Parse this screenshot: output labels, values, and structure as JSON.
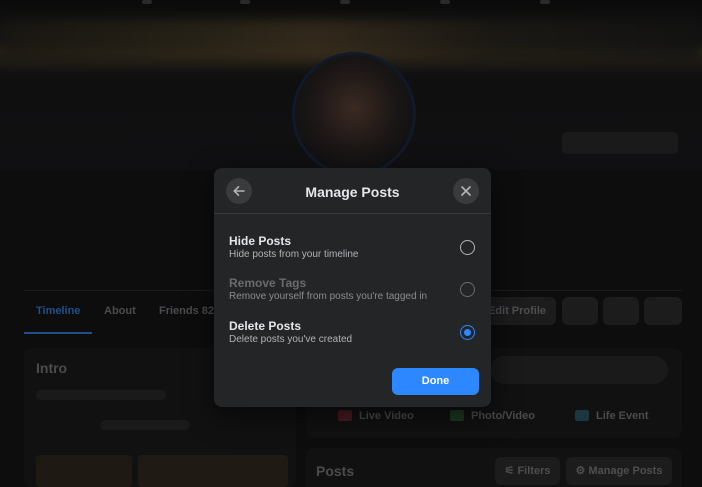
{
  "background": {
    "tabs": [
      "Timeline",
      "About",
      "Friends 822"
    ],
    "edit_profile": "Edit Profile",
    "intro_title": "Intro",
    "composer": {
      "live_video": "Live Video",
      "photo_video": "Photo/Video",
      "life_event": "Life Event"
    },
    "posts_title": "Posts",
    "filters_label": "Filters",
    "manage_posts_label": "Manage Posts"
  },
  "modal": {
    "title": "Manage Posts",
    "back_icon": "arrow-left-icon",
    "close_icon": "close-icon",
    "options": [
      {
        "label": "Hide Posts",
        "description": "Hide posts from your timeline",
        "selected": false,
        "disabled": false
      },
      {
        "label": "Remove Tags",
        "description": "Remove yourself from posts you're tagged in",
        "selected": false,
        "disabled": true
      },
      {
        "label": "Delete Posts",
        "description": "Delete posts you've created",
        "selected": true,
        "disabled": false
      }
    ],
    "done_label": "Done"
  },
  "colors": {
    "accent": "#2d88ff",
    "modal_bg": "#242526",
    "overlay_bg": "#0b0b0c"
  }
}
